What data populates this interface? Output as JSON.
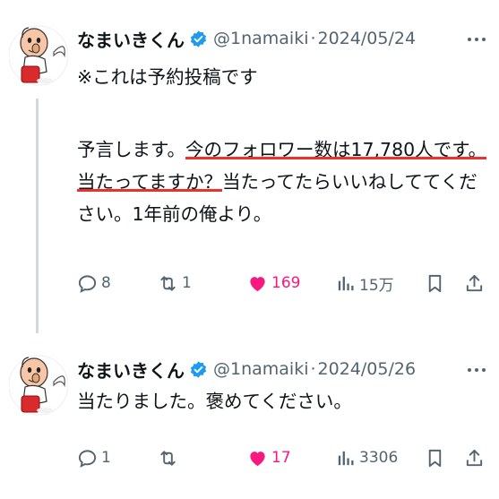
{
  "tweets": [
    {
      "name": "なまいきくん",
      "handle": "@1namaiki",
      "separator": "·",
      "date": "2024/05/24",
      "note": "※これは予約投稿です",
      "text_lines": [
        [
          {
            "t": "予言します。",
            "u": false
          },
          {
            "t": "今のフォロワー数は17,780人です。",
            "u": true
          }
        ],
        [
          {
            "t": "当たってますか？",
            "u": true
          },
          {
            "t": "当たってたらいいねしててくだ",
            "u": false
          }
        ],
        [
          {
            "t": "さい。1年前の俺より。",
            "u": false
          }
        ]
      ],
      "replies": "8",
      "retweets": "1",
      "likes": "169",
      "views": "15万",
      "liked": true
    },
    {
      "name": "なまいきくん",
      "handle": "@1namaiki",
      "separator": "·",
      "date": "2024/05/26",
      "text": "当たりました。褒めてください。",
      "replies": "1",
      "retweets": "",
      "likes": "17",
      "views": "3306",
      "liked": true
    }
  ],
  "colors": {
    "verified": "#1d9bf0",
    "like": "#f91880",
    "underline": "#e8332c",
    "muted": "#536471",
    "thread_line": "#cfd9de"
  },
  "icons": [
    "avatar-mascot",
    "verified-badge-icon",
    "more-icon",
    "reply-icon",
    "retweet-icon",
    "heart-icon",
    "views-icon",
    "bookmark-icon",
    "share-icon"
  ]
}
